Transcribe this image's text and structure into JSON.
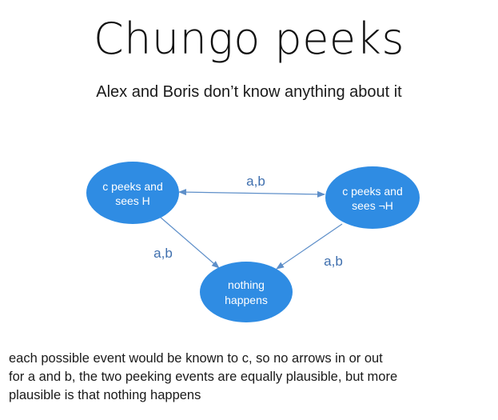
{
  "title": "Chungo peeks",
  "subtitle": "Alex and Boris don’t know anything about it",
  "diagram": {
    "node_color": "#2f8ce3",
    "edge_color": "#5e8fc9",
    "label_color": "#3f6fae",
    "nodes": [
      {
        "id": "peek-h",
        "lines": [
          "c peeks and",
          "sees H"
        ]
      },
      {
        "id": "peek-not-h",
        "lines": [
          "c peeks and",
          "sees ¬H"
        ]
      },
      {
        "id": "nothing",
        "lines": [
          "nothing",
          "happens"
        ]
      }
    ],
    "edges": [
      {
        "from": "peek-h",
        "to": "peek-not-h",
        "label": "a,b",
        "bidirectional": true
      },
      {
        "from": "peek-h",
        "to": "nothing",
        "label": "a,b",
        "bidirectional": false
      },
      {
        "from": "peek-not-h",
        "to": "nothing",
        "label": "a,b",
        "bidirectional": false
      }
    ]
  },
  "caption": {
    "lines": [
      "each possible event would be known to c, so no arrows in or out",
      "for a and b, the two peeking events are equally plausible, but more",
      "plausible is that nothing happens"
    ]
  }
}
